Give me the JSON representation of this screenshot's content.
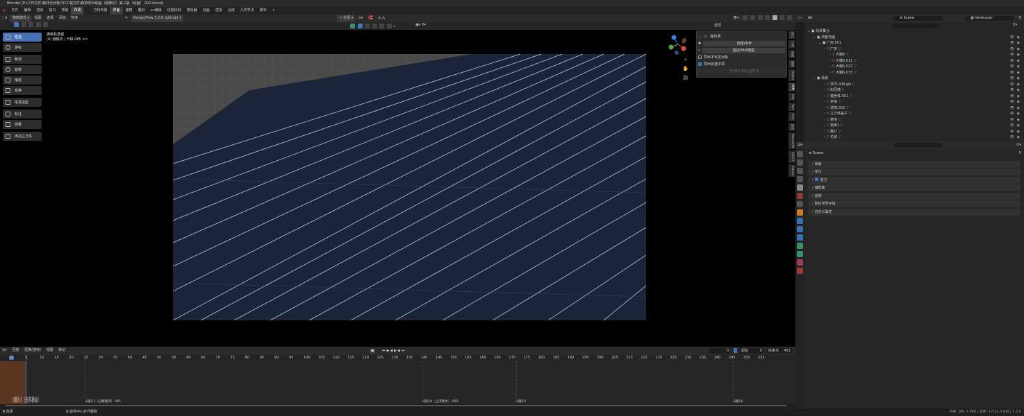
{
  "window": {
    "title": "Blender [E:\\工作文件\\森林光伏板\\3D工程文件\\森林项目动画（摄像机）第三版（动画）.002.blend]"
  },
  "menu": [
    "文件",
    "编辑",
    "渲染",
    "窗口",
    "帮助"
  ],
  "workspaces": [
    "布局",
    "方特布置",
    "界面",
    "建模",
    "雕刻",
    "uv编辑",
    "纹理绘制",
    "着色器",
    "动画",
    "渲染",
    "合成",
    "几何节点",
    "脚本",
    "+"
  ],
  "active_workspace": "界面",
  "vp_header": {
    "mode": "物体模式",
    "view": "视图",
    "select": "选择",
    "add": "添加",
    "object": "物体",
    "addon": "RetopoFlow 3.2.6 (github)",
    "transform": "全局",
    "options": "选项"
  },
  "overlay": {
    "line1": "摄像机透视",
    "line2": "(0) 摄像机 | 卡钳.085 <>"
  },
  "tools": [
    {
      "label": "框选",
      "icon": "cursor-icon",
      "selected": true
    },
    {
      "label": "游标",
      "icon": "cursor-3d-icon"
    },
    {
      "label": "移动",
      "icon": "move-icon"
    },
    {
      "label": "旋转",
      "icon": "rotate-icon"
    },
    {
      "label": "缩放",
      "icon": "scale-icon"
    },
    {
      "label": "变换",
      "icon": "transform-icon"
    },
    {
      "label": "毛发造型",
      "icon": "hair-icon"
    },
    {
      "label": "标注",
      "icon": "annotate-icon"
    },
    {
      "label": "测量",
      "icon": "measure-icon"
    },
    {
      "label": "添加立方体",
      "icon": "add-cube-icon"
    }
  ],
  "vrm_panel": {
    "title": "操作项",
    "create": "创建VRM",
    "validate": "验证VRM模型",
    "opt1": "导出不可见对象",
    "opt2": "导出仅选中项",
    "export": "为VRM 默认值导出"
  },
  "side_tabs": [
    "项目",
    "工具",
    "视图",
    "编辑",
    "Object",
    "VRM",
    "Edit",
    "Tool",
    "Item",
    "物体",
    "BlenderKit",
    "FACEIT",
    "Rokoko"
  ],
  "timeline": {
    "menu": [
      "回放",
      "抠像(插帧)",
      "视图",
      "标记"
    ],
    "current_frame": "0",
    "start_label": "起始",
    "start": "0",
    "end_label": "结束点",
    "end": "482"
  },
  "ruler": [
    "0",
    "5",
    "10",
    "15",
    "20",
    "25",
    "30",
    "35",
    "40",
    "45",
    "50",
    "55",
    "60",
    "65",
    "70",
    "75",
    "80",
    "85",
    "90",
    "95",
    "100",
    "105",
    "110",
    "115",
    "120",
    "125",
    "130",
    "135",
    "140",
    "145",
    "150",
    "155",
    "160",
    "165",
    "170",
    "175",
    "180",
    "185",
    "190",
    "195",
    "200",
    "205",
    "210",
    "215",
    "220",
    "225",
    "230",
    "235",
    "240",
    "245",
    "250",
    "255"
  ],
  "markers": [
    {
      "label": "镜头1（全景镜头）",
      "frame": 0
    },
    {
      "label": "镜头2（光伏俯视）",
      "frame": 0
    },
    {
      "label": "镜头3（分解展示）.001",
      "frame": 25
    },
    {
      "label": "镜头4（上深俯大）.002",
      "frame": 140
    },
    {
      "label": "镜头5",
      "frame": 172
    },
    {
      "label": "镜头6",
      "frame": 246
    }
  ],
  "status": {
    "left": "选择",
    "mid": "旋转中心对齐跟踪",
    "right": "内存: 981.7 MiB | 显存: 17/12.0 GiB | 3.3.0"
  },
  "outliner": {
    "scene": "Scene",
    "view_layer": "ViewLayer",
    "rows": [
      {
        "label": "场景集合",
        "indent": 0
      },
      {
        "label": "测量地面",
        "indent": 1
      },
      {
        "label": "厂房.001",
        "indent": 2
      },
      {
        "label": "厂房",
        "indent": 3
      },
      {
        "label": "大棚6",
        "indent": 4
      },
      {
        "label": "大棚6.011",
        "indent": 4
      },
      {
        "label": "大棚6.022",
        "indent": 4
      },
      {
        "label": "大棚6.033",
        "indent": 4
      },
      {
        "label": "场景",
        "indent": 1
      },
      {
        "label": "草坪.008.glb",
        "indent": 3
      },
      {
        "label": "树冠墙",
        "indent": 3
      },
      {
        "label": "猪舍株.001",
        "indent": 3
      },
      {
        "label": "家墙",
        "indent": 3
      },
      {
        "label": "测墙.002",
        "indent": 3
      },
      {
        "label": "立方体盖子",
        "indent": 3
      },
      {
        "label": "菜地",
        "indent": 3
      },
      {
        "label": "窗扇1",
        "indent": 3
      },
      {
        "label": "路灯",
        "indent": 3
      },
      {
        "label": "花道",
        "indent": 3
      },
      {
        "label": "花道1",
        "indent": 3
      }
    ]
  },
  "properties": {
    "scene_name": "Scene",
    "sections": [
      "场景",
      "单位",
      "重力",
      "辅助集",
      "音频",
      "刚体世界环境",
      "自定义属性"
    ]
  }
}
